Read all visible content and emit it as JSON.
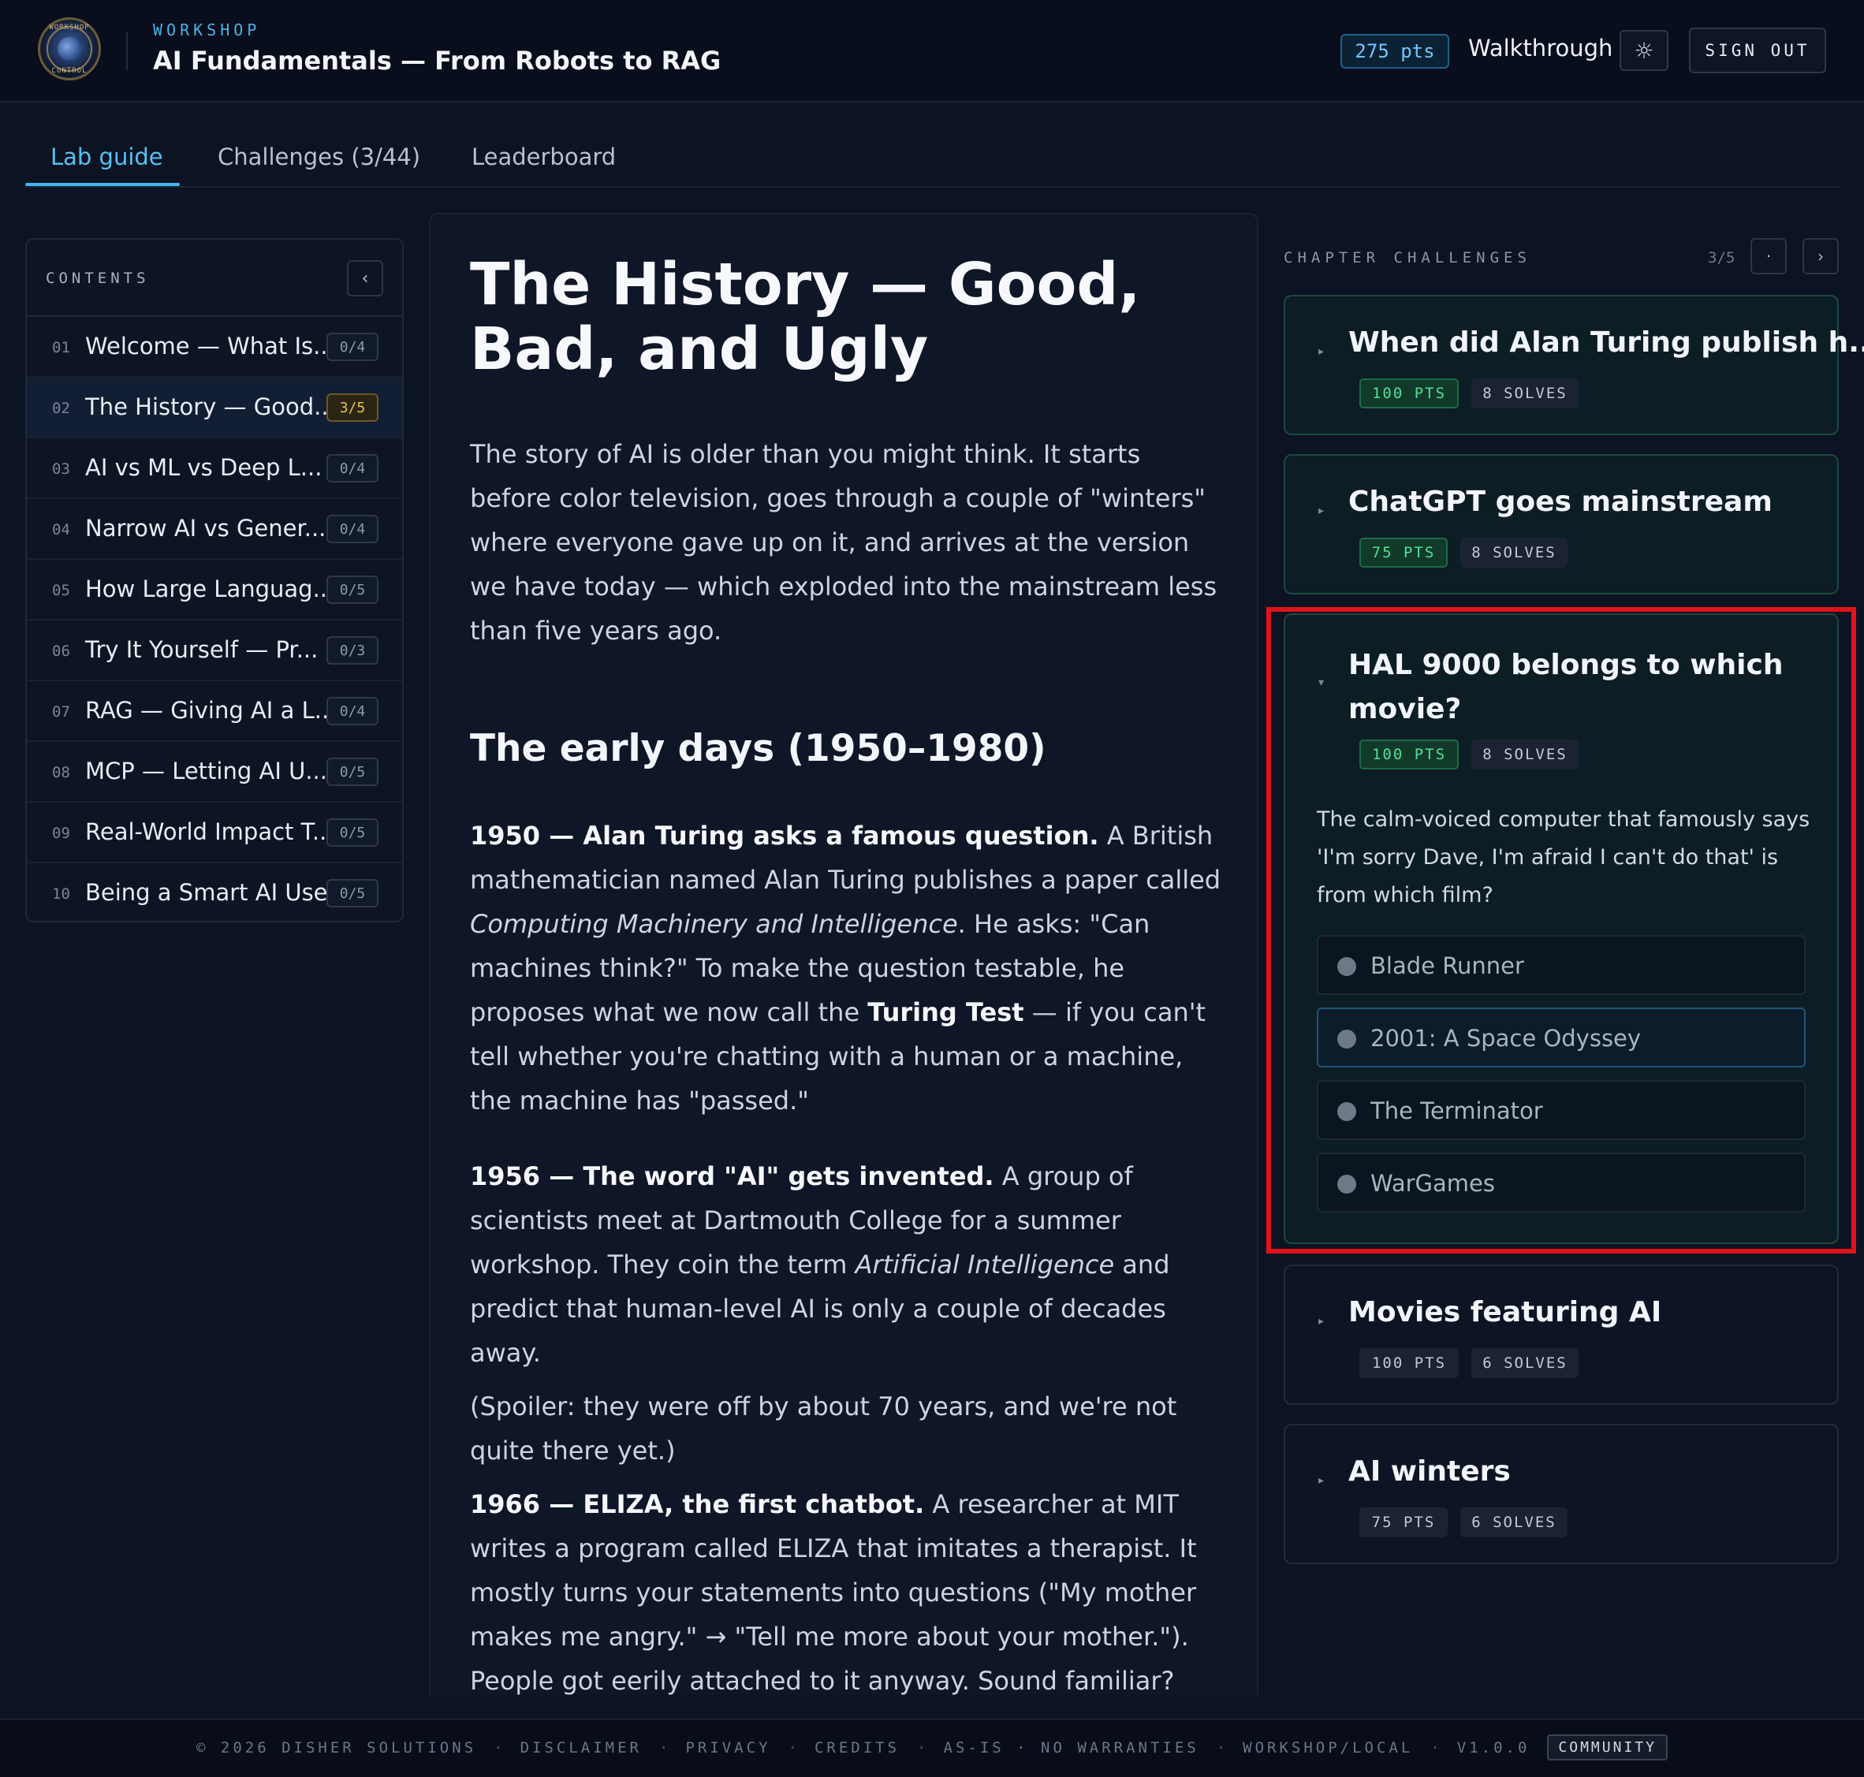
{
  "header": {
    "logo_top": "WORKSHOP",
    "logo_bottom": "CONTROL",
    "kicker": "WORKSHOP",
    "title": "AI Fundamentals — From Robots to RAG",
    "points": "275 pts",
    "walkthrough": "Walkthrough",
    "theme_icon": "☼",
    "sign_out": "SIGN OUT"
  },
  "tabs": [
    {
      "label": "Lab guide"
    },
    {
      "label": "Challenges (3/44)"
    },
    {
      "label": "Leaderboard"
    }
  ],
  "sidebar": {
    "title": "CONTENTS",
    "collapse_icon": "‹",
    "items": [
      {
        "num": "01",
        "label": "Welcome — What Is...",
        "progress": "0/4"
      },
      {
        "num": "02",
        "label": "The History — Good...",
        "progress": "3/5"
      },
      {
        "num": "03",
        "label": "AI vs ML vs Deep L...",
        "progress": "0/4"
      },
      {
        "num": "04",
        "label": "Narrow AI vs Gener...",
        "progress": "0/4"
      },
      {
        "num": "05",
        "label": "How Large Languag...",
        "progress": "0/5"
      },
      {
        "num": "06",
        "label": "Try It Yourself — Pr...",
        "progress": "0/3"
      },
      {
        "num": "07",
        "label": "RAG — Giving AI a L...",
        "progress": "0/4"
      },
      {
        "num": "08",
        "label": "MCP — Letting AI U...",
        "progress": "0/5"
      },
      {
        "num": "09",
        "label": "Real-World Impact T...",
        "progress": "0/5"
      },
      {
        "num": "10",
        "label": "Being a Smart AI User",
        "progress": "0/5"
      }
    ]
  },
  "article": {
    "title": "The History — Good, Bad, and Ugly",
    "intro": "The story of AI is older than you might think. It starts before color television, goes through a couple of \"winters\" where everyone gave up on it, and arrives at the version we have today — which exploded into the mainstream less than five years ago.",
    "h2": "The early days (1950–1980)",
    "p1": {
      "lead": "1950 — Alan Turing asks a famous question.",
      "t1": " A British mathematician named Alan Turing publishes a paper called ",
      "em": "Computing Machinery and Intelligence",
      "t2": ". He asks: \"Can machines think?\" To make the question testable, he proposes what we now call the ",
      "strong": "Turing Test",
      "t3": " — if you can't tell whether you're chatting with a human or a machine, the machine has \"passed.\""
    },
    "p2": {
      "lead": "1956 — The word \"AI\" gets invented.",
      "t1": " A group of scientists meet at Dartmouth College for a summer workshop. They coin the term ",
      "em": "Artificial Intelligence",
      "t2": " and predict that human-level AI is only a couple of decades away."
    },
    "p3": "(Spoiler: they were off by about 70 years, and we're not quite there yet.)",
    "p4": {
      "lead": "1966 — ELIZA, the first chatbot.",
      "t1": " A researcher at MIT writes a program called ELIZA that imitates a therapist. It mostly turns your statements into questions (\"My mother makes me angry.\" → \"Tell me more about your mother.\"). People got eerily attached to it anyway. Sound familiar?"
    }
  },
  "challenges": {
    "title": "CHAPTER CHALLENGES",
    "count": "3/5",
    "prev_icon": "·",
    "next_icon": "›",
    "cards": [
      {
        "title": "When did Alan Turing publish h...",
        "points": "100 PTS",
        "solves": "8 SOLVES",
        "solved": true,
        "caret": "▸"
      },
      {
        "title": "ChatGPT goes mainstream",
        "points": "75 PTS",
        "solves": "8 SOLVES",
        "solved": true,
        "caret": "▸"
      },
      {
        "title": "HAL 9000 belongs to which movie?",
        "points": "100 PTS",
        "solves": "8 SOLVES",
        "solved": true,
        "caret": "▾",
        "question": "The calm-voiced computer that famously says 'I'm sorry Dave, I'm afraid I can't do that' is from which film?",
        "options": [
          "Blade Runner",
          "2001: A Space Odyssey",
          "The Terminator",
          "WarGames"
        ]
      },
      {
        "title": "Movies featuring AI",
        "points": "100 PTS",
        "solves": "6 SOLVES",
        "solved": false,
        "caret": "▸"
      },
      {
        "title": "AI winters",
        "points": "75 PTS",
        "solves": "6 SOLVES",
        "solved": false,
        "caret": "▸"
      }
    ]
  },
  "footer": {
    "items": [
      "© 2026 DISHER SOLUTIONS",
      "DISCLAIMER",
      "PRIVACY",
      "CREDITS",
      "AS-IS · NO WARRANTIES",
      "WORKSHOP/LOCAL",
      "V1.0.0"
    ],
    "separator": "·",
    "community": "COMMUNITY"
  },
  "colors": {
    "accent": "#41b6ef",
    "solved_green": "#4fe094",
    "highlight_red": "#e0131a"
  }
}
